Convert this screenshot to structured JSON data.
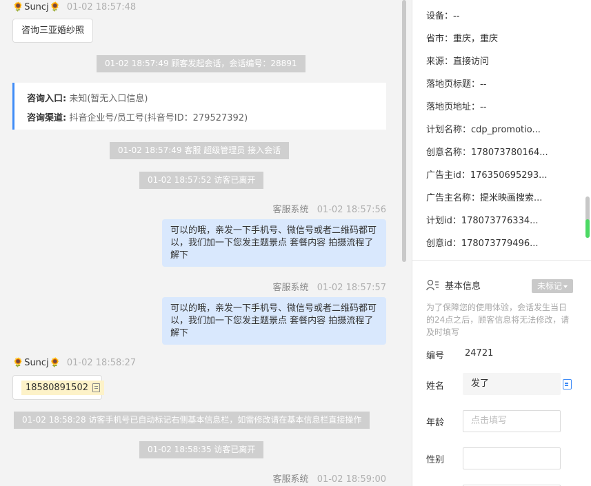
{
  "chat": {
    "visitor_name": "Suncj",
    "visitor_flower": "🌻",
    "msg1_time": "01-02 18:57:48",
    "msg1_text": "咨询三亚婚纱照",
    "sys1": "01-02 18:57:49 顾客发起会话，会话编号：28891",
    "entry_label": "咨询入口:",
    "entry_value": "未知(暂无入口信息)",
    "channel_label": "咨询渠道:",
    "channel_value": "抖音企业号/员工号(抖音号ID：279527392)",
    "sys2": "01-02 18:57:49 客服 超级管理员 接入会话",
    "sys3": "01-02 18:57:52 访客已离开",
    "agent_name": "客服系统",
    "agent1_time": "01-02 18:57:56",
    "agent1_text": "可以的哦，亲发一下手机号、微信号或者二维码都可以，我们加一下您发主题景点 套餐内容 拍摄流程了解下",
    "agent2_time": "01-02 18:57:57",
    "agent2_text": "可以的哦，亲发一下手机号、微信号或者二维码都可以，我们加一下您发主题景点 套餐内容 拍摄流程了解下",
    "msg2_time": "01-02 18:58:27",
    "phone": "18580891502",
    "sys4": "01-02 18:58:28 访客手机号已自动标记右侧基本信息栏，如需修改请在基本信息栏直接操作",
    "sys5": "01-02 18:58:35 访客已离开",
    "agent3_time": "01-02 18:59:00"
  },
  "info": {
    "rows": [
      "设备：--",
      "省市：重庆，重庆",
      "来源：直接访问",
      "落地页标题：--",
      "落地页地址：--",
      "计划名称：cdp_promotio...",
      "创意名称：178073780164...",
      "广告主id：176350695293...",
      "广告主名称：提米映画搜索...",
      "计划id：178073776334...",
      "创意id：178073779496..."
    ],
    "basic_title": "基本信息",
    "tag_label": "未标记",
    "hint": "为了保障您的使用体验，会话发生当日的24点之后，顾客信息将无法修改，请及时填写",
    "id_label": "编号",
    "id_value": "24721",
    "name_label": "姓名",
    "name_value": "发了",
    "age_label": "年龄",
    "age_placeholder": "点击填写",
    "gender_label": "性别",
    "gender_value": ""
  },
  "colors": {
    "accent": "#3f8cf7",
    "agent_bubble": "#d9e8fd",
    "system_bar": "#cfcfcf",
    "phone_highlight": "#fdf2c8"
  }
}
